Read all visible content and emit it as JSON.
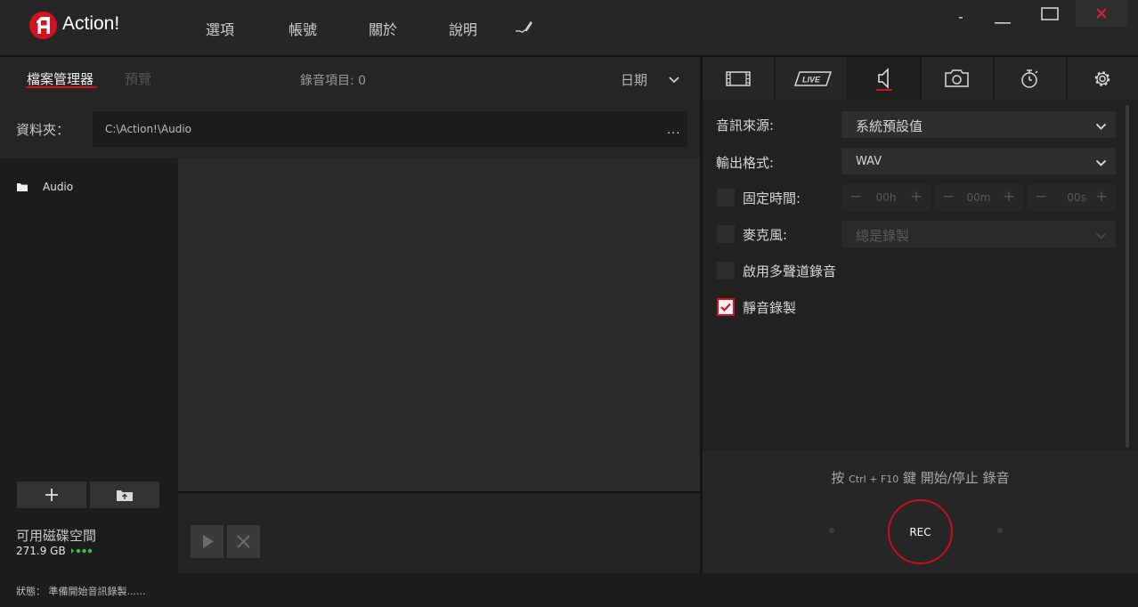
{
  "app": {
    "title": "Action!"
  },
  "menu": {
    "options": "選項",
    "account": "帳號",
    "about": "關於",
    "help": "說明"
  },
  "left": {
    "tabs": {
      "file_manager": "檔案管理器",
      "preview": "預覽"
    },
    "record_count_label": "錄音項目:",
    "record_count": "0",
    "sort_by": "日期",
    "folder_label": "資料夾：",
    "folder_path": "C:\\Action!\\Audio",
    "folder_browse": "...",
    "tree": [
      {
        "label": "Audio",
        "icon": "folder-icon"
      }
    ],
    "disk": {
      "label": "可用磁碟空間",
      "size": "271.9 GB"
    }
  },
  "right": {
    "tabs": [
      {
        "name": "tab-video",
        "icon": "film-icon"
      },
      {
        "name": "tab-live",
        "icon": "live-icon"
      },
      {
        "name": "tab-audio",
        "icon": "speaker-icon",
        "active": true
      },
      {
        "name": "tab-screenshot",
        "icon": "camera-icon"
      },
      {
        "name": "tab-timer",
        "icon": "stopwatch-icon"
      },
      {
        "name": "tab-settings",
        "icon": "gear-icon"
      }
    ],
    "audio_source": {
      "label": "音訊來源:",
      "value": "系統預設值"
    },
    "output_format": {
      "label": "輸出格式:",
      "value": "WAV"
    },
    "fixed_time": {
      "label": "固定時間:",
      "checked": false,
      "hours": "00h",
      "minutes": "00m",
      "seconds": "00s"
    },
    "microphone": {
      "label": "麥克風:",
      "checked": false,
      "value": "總是錄製"
    },
    "multichannel": {
      "label": "啟用多聲道錄音",
      "checked": false
    },
    "mute_record": {
      "label": "靜音錄製",
      "checked": true
    },
    "hotkey": {
      "prefix": "按",
      "key": "Ctrl + F10",
      "suffix": "鍵 開始/停止 錄音"
    },
    "rec_label": "REC"
  },
  "status": {
    "label": "狀態：",
    "text": "準備開始音訊錄製......"
  },
  "colors": {
    "accent": "#d4121e",
    "background": "#1e1e1e",
    "disk_indicator": "#3fbf4a"
  }
}
